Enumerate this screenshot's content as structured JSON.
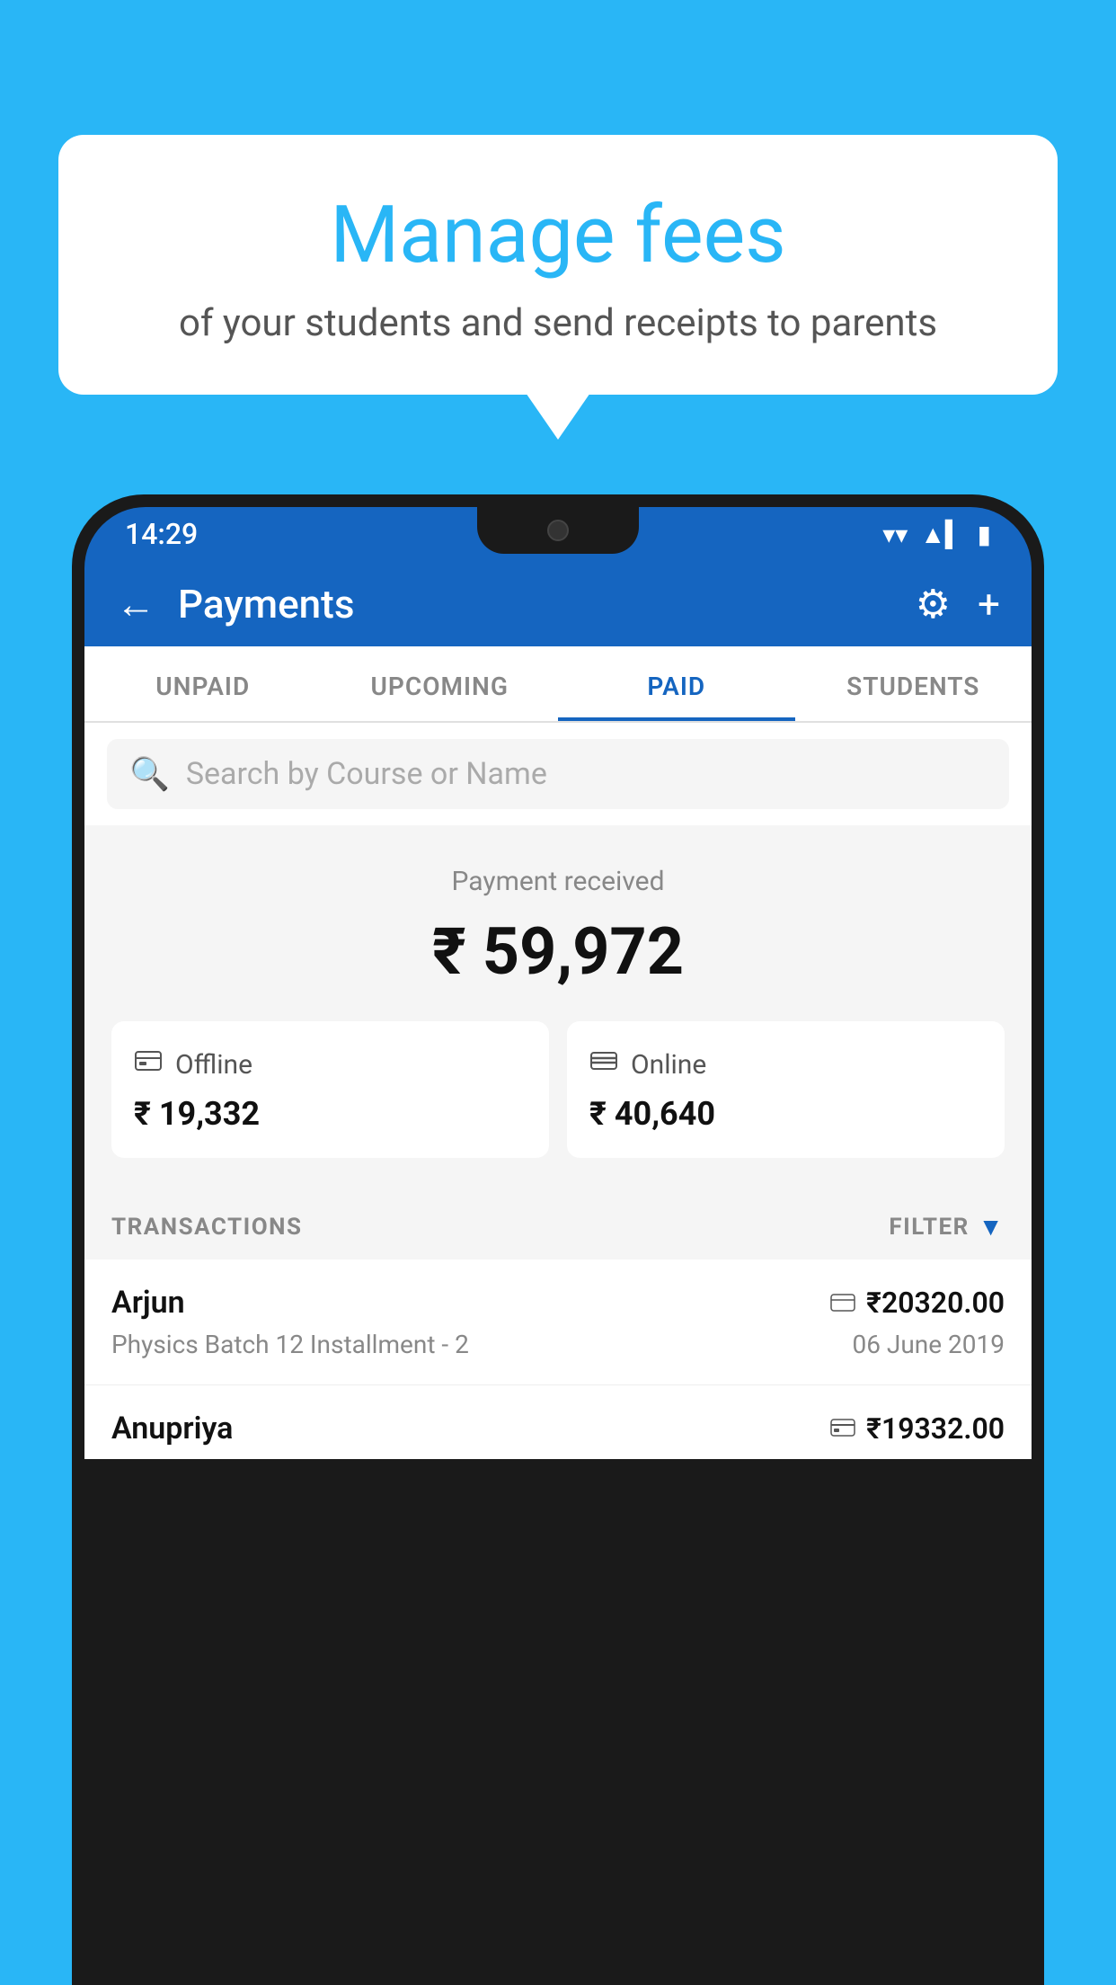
{
  "background_color": "#29B6F6",
  "speech_bubble": {
    "title": "Manage fees",
    "subtitle": "of your students and send receipts to parents"
  },
  "status_bar": {
    "time": "14:29",
    "wifi_icon": "▼",
    "signal_icon": "▲",
    "battery_icon": "▮"
  },
  "header": {
    "title": "Payments",
    "back_label": "←",
    "gear_label": "⚙",
    "plus_label": "+"
  },
  "tabs": [
    {
      "label": "UNPAID",
      "active": false
    },
    {
      "label": "UPCOMING",
      "active": false
    },
    {
      "label": "PAID",
      "active": true
    },
    {
      "label": "STUDENTS",
      "active": false
    }
  ],
  "search": {
    "placeholder": "Search by Course or Name"
  },
  "payment_summary": {
    "label": "Payment received",
    "total": "₹ 59,972",
    "offline_label": "Offline",
    "offline_amount": "₹ 19,332",
    "online_label": "Online",
    "online_amount": "₹ 40,640"
  },
  "transactions": {
    "header_label": "TRANSACTIONS",
    "filter_label": "FILTER",
    "rows": [
      {
        "name": "Arjun",
        "amount": "₹20320.00",
        "course": "Physics Batch 12 Installment - 2",
        "date": "06 June 2019",
        "payment_type": "card"
      },
      {
        "name": "Anupriya",
        "amount": "₹19332.00",
        "course": "",
        "date": "",
        "payment_type": "offline"
      }
    ]
  },
  "icons": {
    "search": "🔍",
    "gear": "⚙",
    "plus": "+",
    "back": "←",
    "card": "💳",
    "offline_payment": "₹",
    "filter": "▼"
  }
}
